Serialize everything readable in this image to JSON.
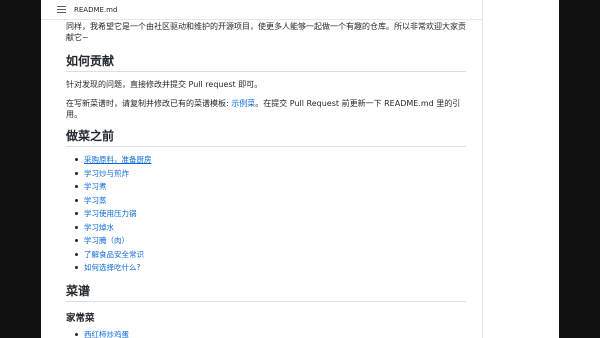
{
  "file_header": {
    "file_name": "README.md",
    "icon": "list-icon"
  },
  "intro": {
    "text": "同样，我希望它是一个由社区驱动和维护的开源项目，使更多人能够一起做一个有趣的仓库。所以非常欢迎大家贡献它~"
  },
  "contribute": {
    "heading": "如何贡献",
    "line1": "针对发现的问题，直接修改并提交 Pull request 即可。",
    "line2_before": "在写新菜谱时，请复制并修改已有的菜谱模板: ",
    "line2_link": "示例菜",
    "line2_after": "。在提交 Pull Request 前更新一下 README.md 里的引用。"
  },
  "before_cooking": {
    "heading": "做菜之前",
    "items": [
      "采购原料，准备厨房",
      "学习炒与煎炸",
      "学习煮",
      "学习蒸",
      "学习使用压力锅",
      "学习焯水",
      "学习腌（肉）",
      "了解食品安全常识",
      "如何选择吃什么?"
    ]
  },
  "recipes": {
    "heading": "菜谱",
    "subheading": "家常菜",
    "partial_item": "西红柿炒鸡蛋"
  },
  "colors": {
    "link": "#0969da",
    "text": "#24292f",
    "background": "#ffffff",
    "frame": "#000000"
  }
}
